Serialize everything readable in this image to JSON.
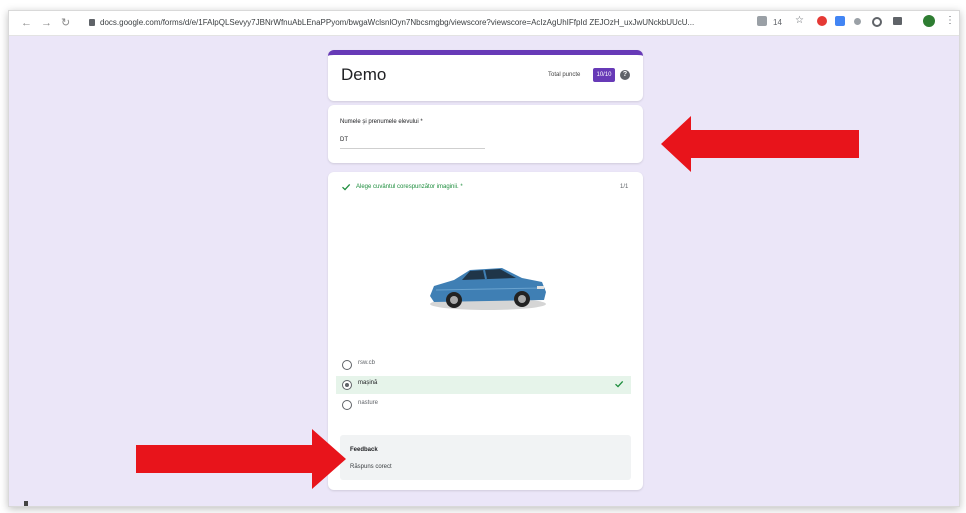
{
  "browser": {
    "url": "docs.google.com/forms/d/e/1FAlpQLSevyy7JBNrWfnuAbLEnaPPyom/bwgaWclsnlOyn7Nbcsmgbg/viewscore?viewscore=AcIzAgUhIFfpId ZEJOzH_uxJwUNckbUUcU...",
    "zoom_text": "14"
  },
  "form": {
    "title": "Demo",
    "total_label": "Total puncte",
    "score": "10/10"
  },
  "name_question": {
    "label": "Numele și prenumele elevului *",
    "value": "DT"
  },
  "question": {
    "label": "Alege cuvântul corespunzător imaginii. *",
    "score": "1/1",
    "options": [
      {
        "label": "rsw.cb",
        "selected": false,
        "correct": false
      },
      {
        "label": "mașină",
        "selected": true,
        "correct": true
      },
      {
        "label": "nasture",
        "selected": false,
        "correct": false
      }
    ]
  },
  "feedback": {
    "title": "Feedback",
    "text": "Răspuns corect"
  },
  "colors": {
    "accent": "#673ab7",
    "page_bg": "#ebe6f8",
    "correct": "#1e8e3e",
    "annotation_arrow": "#e8141b"
  }
}
